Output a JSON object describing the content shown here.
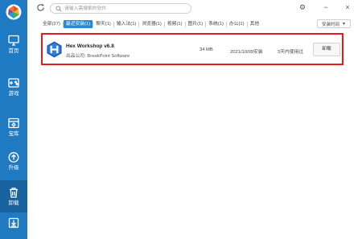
{
  "sidebar": {
    "items": [
      {
        "label": "首页",
        "icon": "monitor-icon"
      },
      {
        "label": "游戏",
        "icon": "gamepad-icon"
      },
      {
        "label": "宝库",
        "icon": "shield-icon"
      },
      {
        "label": "升级",
        "icon": "upgrade-icon"
      },
      {
        "label": "卸载",
        "icon": "trash-icon",
        "active": true
      },
      {
        "label": "",
        "icon": "download-icon"
      }
    ]
  },
  "search": {
    "placeholder": "请输入需搜索的软件"
  },
  "window": {
    "settings": "⚙",
    "minimize": "−",
    "close": "×"
  },
  "filters": [
    {
      "label": "全部(27)"
    },
    {
      "label": "最近安装(1)",
      "active": true
    },
    {
      "label": "聊天(1)"
    },
    {
      "label": "输入法(1)"
    },
    {
      "label": "浏览器(1)"
    },
    {
      "label": "视频(1)"
    },
    {
      "label": "图片(1)"
    },
    {
      "label": "系统(1)"
    },
    {
      "label": "办公(1)"
    },
    {
      "label": "其他"
    }
  ],
  "sort": {
    "label": "安装时间"
  },
  "app": {
    "name": "Hex Workshop v6.8",
    "publisher": "出品公司: BreakPoint Software",
    "size": "34 MB",
    "install_date": "2021/10/09安装",
    "usage": "3天内使用过",
    "uninstall_label": "卸载"
  },
  "colors": {
    "sidebar": "#1f7ac2",
    "accent": "#2a8ad9",
    "highlight_border": "#e41c1c"
  }
}
